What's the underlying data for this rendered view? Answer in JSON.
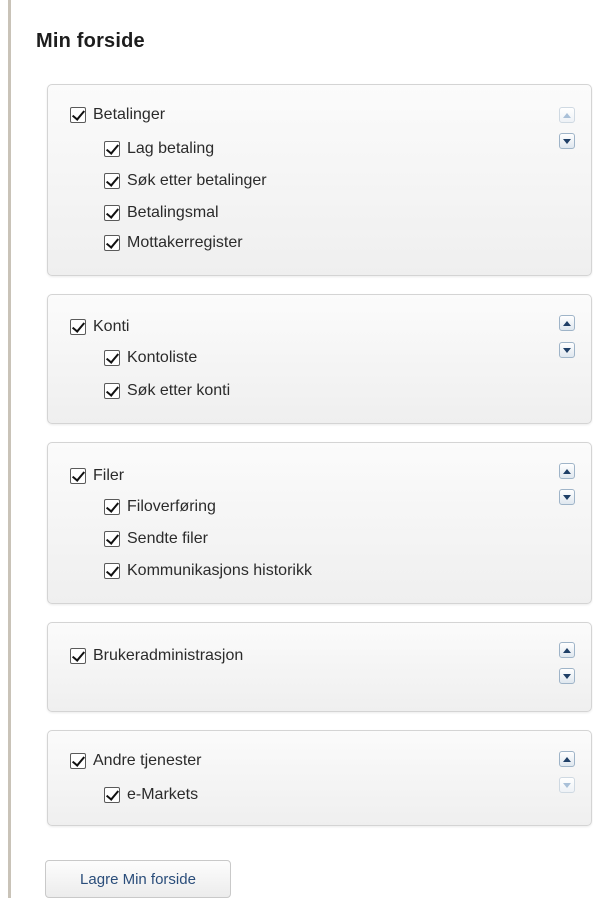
{
  "page": {
    "title": "Min forside"
  },
  "sections": [
    {
      "label": "Betalinger",
      "checked": true,
      "up_enabled": false,
      "down_enabled": true,
      "items": [
        {
          "label": "Lag betaling",
          "checked": true
        },
        {
          "label": "Søk etter betalinger",
          "checked": true
        },
        {
          "label": "Betalingsmal",
          "checked": true
        },
        {
          "label": "Mottakerregister",
          "checked": true
        }
      ]
    },
    {
      "label": "Konti",
      "checked": true,
      "up_enabled": true,
      "down_enabled": true,
      "items": [
        {
          "label": "Kontoliste",
          "checked": true
        },
        {
          "label": "Søk etter konti",
          "checked": true
        }
      ]
    },
    {
      "label": "Filer",
      "checked": true,
      "up_enabled": true,
      "down_enabled": true,
      "items": [
        {
          "label": "Filoverføring",
          "checked": true
        },
        {
          "label": "Sendte filer",
          "checked": true
        },
        {
          "label": "Kommunikasjons historikk",
          "checked": true
        }
      ]
    },
    {
      "label": "Brukeradministrasjon",
      "checked": true,
      "up_enabled": true,
      "down_enabled": true,
      "items": []
    },
    {
      "label": "Andre tjenester",
      "checked": true,
      "up_enabled": true,
      "down_enabled": false,
      "items": [
        {
          "label": "e-Markets",
          "checked": true
        }
      ]
    }
  ],
  "save_button": {
    "label": "Lagre Min forside"
  },
  "colors": {
    "arrow": "#1f3f67",
    "button_text": "#2a4d7a",
    "panel_border": "#d4d4d4"
  }
}
